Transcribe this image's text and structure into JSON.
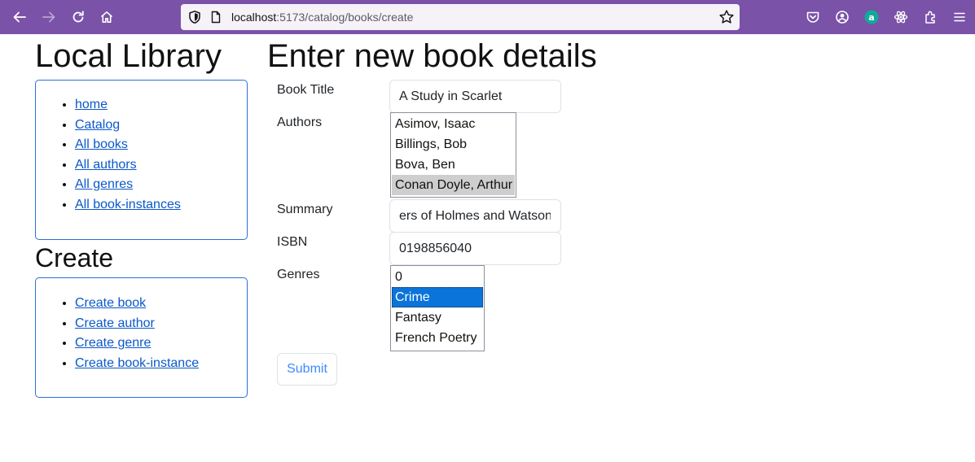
{
  "browser": {
    "url_host": "localhost",
    "url_rest": ":5173/catalog/books/create",
    "colors": {
      "toolbar": "#7a52a8",
      "urlbar": "#f5f2f8"
    },
    "icons": [
      "back-arrow-icon",
      "forward-arrow-icon",
      "reload-icon",
      "home-icon",
      "shield-icon",
      "page-icon",
      "star-icon",
      "pocket-icon",
      "account-icon",
      "extension-a-icon",
      "react-icon",
      "extensions-icon",
      "menu-icon"
    ]
  },
  "sidebar": {
    "title": "Local Library",
    "nav_links": [
      "home",
      "Catalog",
      "All books",
      "All authors",
      "All genres",
      "All book-instances"
    ],
    "create_title": "Create",
    "create_links": [
      "Create book",
      "Create author",
      "Create genre",
      "Create book-instance"
    ]
  },
  "form": {
    "heading": "Enter new book details",
    "title_label": "Book Title",
    "title_value": "A Study in Scarlet",
    "authors_label": "Authors",
    "authors_options": [
      "Asimov, Isaac",
      "Billings, Bob",
      "Bova, Ben",
      "Conan Doyle, Arthur"
    ],
    "authors_selected": "Conan Doyle, Arthur",
    "summary_label": "Summary",
    "summary_value": "ers of Holmes and Watson.",
    "isbn_label": "ISBN",
    "isbn_value": "0198856040",
    "genres_label": "Genres",
    "genres_options": [
      "0",
      "Crime",
      "Fantasy",
      "French Poetry"
    ],
    "genres_selected": "Crime",
    "submit_label": "Submit"
  }
}
